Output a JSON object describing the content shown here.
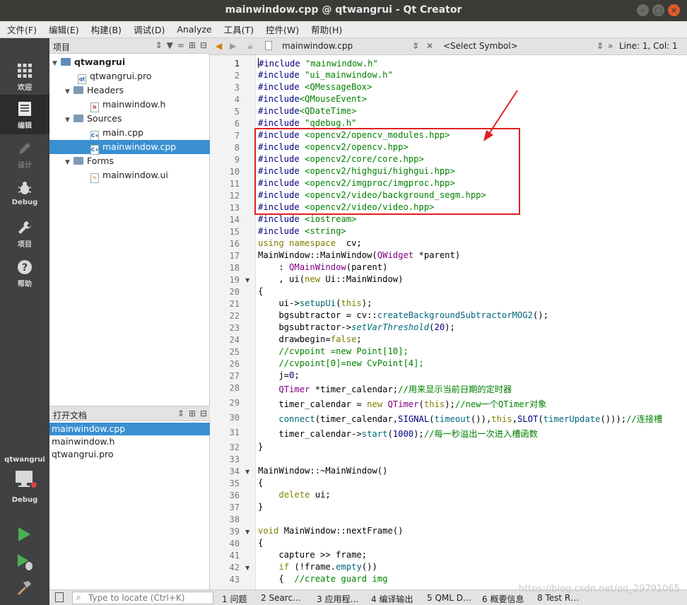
{
  "window": {
    "title": "mainwindow.cpp @ qtwangrui - Qt Creator"
  },
  "menu": [
    "文件(F)",
    "编辑(E)",
    "构建(B)",
    "调试(D)",
    "Analyze",
    "工具(T)",
    "控件(W)",
    "帮助(H)"
  ],
  "modes": [
    {
      "label": "欢迎",
      "icon": "grid-icon"
    },
    {
      "label": "编辑",
      "icon": "document-icon"
    },
    {
      "label": "设计",
      "icon": "pencil-icon"
    },
    {
      "label": "Debug",
      "icon": "bug-icon"
    },
    {
      "label": "项目",
      "icon": "wrench-icon"
    },
    {
      "label": "帮助",
      "icon": "help-icon"
    }
  ],
  "target": {
    "project": "qtwangrui",
    "config": "Debug"
  },
  "project_panel": {
    "title": "项目",
    "tree": [
      {
        "label": "qtwangrui",
        "bold": true
      },
      {
        "label": "qtwangrui.pro"
      },
      {
        "label": "Headers"
      },
      {
        "label": "mainwindow.h"
      },
      {
        "label": "Sources"
      },
      {
        "label": "main.cpp"
      },
      {
        "label": "mainwindow.cpp",
        "selected": true
      },
      {
        "label": "Forms"
      },
      {
        "label": "mainwindow.ui"
      }
    ]
  },
  "open_docs": {
    "title": "打开文档",
    "items": [
      "mainwindow.cpp",
      "mainwindow.h",
      "qtwangrui.pro"
    ]
  },
  "editor": {
    "file": "mainwindow.cpp",
    "symbol": "<Select Symbol>",
    "position": "Line: 1, Col: 1",
    "line_numbers": [
      "1",
      "2",
      "3",
      "4",
      "5",
      "6",
      "7",
      "8",
      "9",
      "10",
      "11",
      "12",
      "13",
      "14",
      "15",
      "16",
      "17",
      "18",
      "19",
      "20",
      "21",
      "22",
      "23",
      "24",
      "25",
      "26",
      "27",
      "28",
      "29",
      "30",
      "31",
      "32",
      "33",
      "34",
      "35",
      "36",
      "37",
      "38",
      "39",
      "40",
      "41",
      "42",
      "43"
    ],
    "lines": [
      "#include \"mainwindow.h\"",
      "#include \"ui_mainwindow.h\"",
      "#include <QMessageBox>",
      "#include<QMouseEvent>",
      "#include<QDateTime>",
      "#include \"qdebug.h\"",
      "#include <opencv2/opencv_modules.hpp>",
      "#include <opencv2/opencv.hpp>",
      "#include <opencv2/core/core.hpp>",
      "#include <opencv2/highgui/highgui.hpp>",
      "#include <opencv2/imgproc/imgproc.hpp>",
      "#include <opencv2/video/background_segm.hpp>",
      "#include <opencv2/video/video.hpp>",
      "#include <iostream>",
      "#include <string>",
      "using namespace  cv;",
      "MainWindow::MainWindow(QWidget *parent)",
      "    : QMainWindow(parent)",
      "    , ui(new Ui::MainWindow)",
      "{",
      "    ui->setupUi(this);",
      "    bgsubtractor = cv::createBackgroundSubtractorMOG2();",
      "    bgsubtractor->setVarThreshold(20);",
      "    drawbegin=false;",
      "    //cvpoint =new Point[10];",
      "    //cvpoint[0]=new CvPoint[4];",
      "    j=0;",
      "    QTimer *timer_calendar;//用来显示当前日期的定时器",
      "    timer_calendar = new QTimer(this);//new一个QTimer对象",
      "    connect(timer_calendar,SIGNAL(timeout()),this,SLOT(timerUpdate()));//连接槽",
      "    timer_calendar->start(1000);//每一秒溢出一次进入槽函数",
      "}",
      "",
      "MainWindow::~MainWindow()",
      "{",
      "    delete ui;",
      "}",
      "",
      "void MainWindow::nextFrame()",
      "{",
      "    capture >> frame;",
      "    if (!frame.empty())",
      "    {  //create guard img"
    ]
  },
  "locator": {
    "placeholder": "Type to locate (Ctrl+K)"
  },
  "output_tabs": [
    "1 问题",
    "2 Searc…",
    "3 应用程…",
    "4 编译输出",
    "5 QML D…",
    "6 概要信息",
    "8 Test R…"
  ],
  "watermark": "https://blog.csdn.net/qq_29791065"
}
